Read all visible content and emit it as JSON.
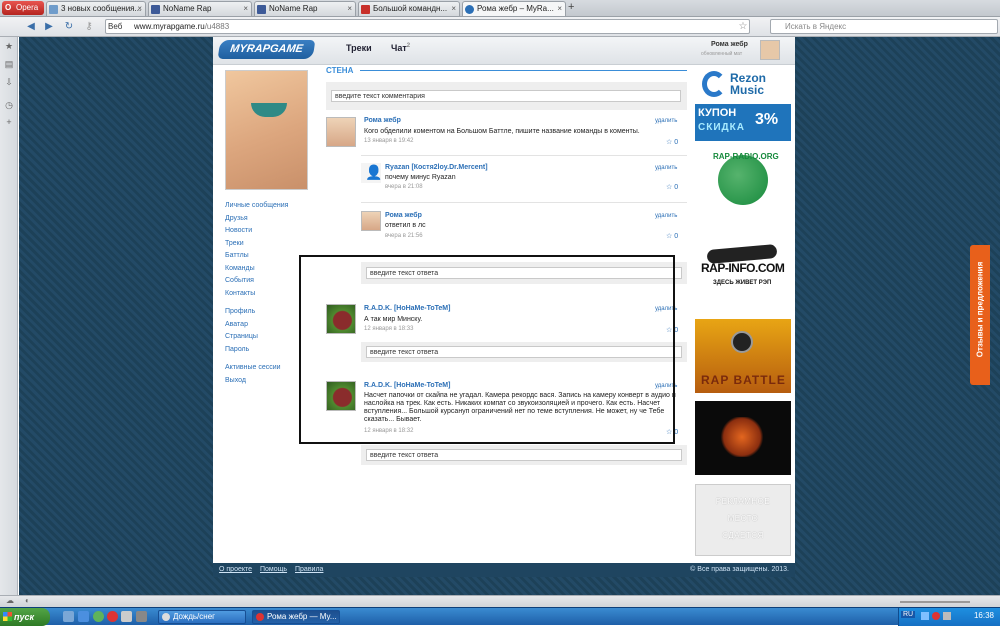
{
  "browser": {
    "menu_label": "Opera",
    "tabs": [
      {
        "label": "3 новых сообщения..."
      },
      {
        "label": "NoName Rap"
      },
      {
        "label": "NoName Rap"
      },
      {
        "label": "Большой командн..."
      },
      {
        "label": "Рома жебр – MyRa..."
      }
    ],
    "web_label": "Веб",
    "url_host": "www.myrapgame.ru",
    "url_path": "/u4883",
    "search_placeholder": "Искать в Яндекс"
  },
  "site": {
    "logo": "MYRAPGAME",
    "nav": [
      {
        "label": "Треки",
        "sup": ""
      },
      {
        "label": "Чат",
        "sup": "2"
      }
    ],
    "user_name": "Рома жебр",
    "user_status": "обновленный мат"
  },
  "sidebar": {
    "menu1": [
      "Личные сообщения",
      "Друзья",
      "Новости",
      "Треки",
      "Баттлы",
      "Команды",
      "События",
      "Контакты"
    ],
    "menu2": [
      "Профиль",
      "Аватар",
      "Страницы",
      "Пароль"
    ],
    "menu3": [
      "Активные сессии",
      "Выход"
    ]
  },
  "wall": {
    "title": "СТЕНА",
    "comment_placeholder": "введите текст комментария",
    "reply_placeholder": "введите текст ответа",
    "delete_label": "удалить",
    "like_count": "0",
    "posts": [
      {
        "name": "Рома жебр",
        "text": "Кого обделили коментом на Большом Баттле, пишите название команды в коменты.",
        "date": "13 января в 19:42"
      },
      {
        "name": "Ryazan [Костя2loy.Dr.Mercent]",
        "text": "почему минус Ryazan",
        "date": "вчера в 21:08"
      },
      {
        "name": "Рома жебр",
        "text": "ответил в лс",
        "date": "вчера в 21:56"
      },
      {
        "name": "R.A.D.K. [НоНаМе-ToTeM]",
        "text": "А так мир Минску.",
        "date": "12 января в 18:33"
      },
      {
        "name": "R.A.D.K. [НоНаМе-ToTeM]",
        "text": "Насчет папочки от скайпа не угадал. Камера рекордс вася. Запись на камеру конверт в аудио и наслойка на трек. Как есть. Никаких компат со звукоизоляцией и прочего. Как есть. Насчет вступления... Большой курсануп ограничений нет по теме вступления. Не может, ну че Тебе сказать... Бывает.",
        "date": "12 января в 18:32"
      }
    ]
  },
  "ads": {
    "rezon": "Rezon Music",
    "coupon_title": "КУПОН",
    "coupon_sub": "СКИДКА",
    "coupon_pct": "3%",
    "rapradio": "RAP-RADIO.ORG",
    "rapinfo": "RAP-INFO.COM",
    "rapinfo_sub": "ЗДЕСЬ ЖИВЕТ РЭП",
    "rapbattle": "RAP BATTLE",
    "place": [
      "РЕКЛАМНОЕ",
      "МЕСТО",
      "СДАЕТСЯ"
    ]
  },
  "footer": {
    "links": [
      "О проекте",
      "Помощь",
      "Правила"
    ],
    "copyright": "© Все права защищены. 2013."
  },
  "feedback": "Отзывы и предложения",
  "taskbar": {
    "start": "пуск",
    "tasks": [
      "Дождь/снег",
      "Рома жебр — My..."
    ],
    "lang": "RU",
    "clock": "16:38"
  },
  "colors": {
    "link": "#2b6fb6",
    "accent": "#3a8dd8",
    "bg": "#1f4560",
    "feedback": "#e8601b"
  }
}
